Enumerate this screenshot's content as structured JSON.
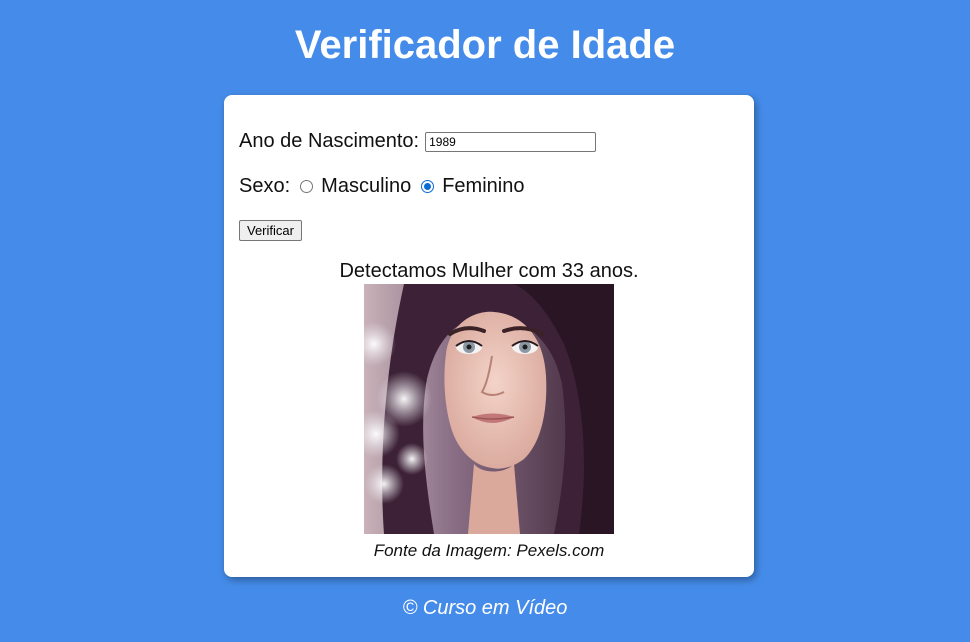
{
  "header": {
    "title": "Verificador de Idade"
  },
  "form": {
    "birth_label": "Ano de Nascimento:",
    "birth_value": "1989",
    "sex_label": "Sexo:",
    "options": [
      {
        "label": "Masculino",
        "checked": false
      },
      {
        "label": "Feminino",
        "checked": true
      }
    ],
    "submit_label": "Verificar"
  },
  "result": {
    "message": "Detectamos Mulher com 33 anos.",
    "image_caption": "Fonte da Imagem: Pexels.com"
  },
  "footer": {
    "text": "© Curso em Vídeo"
  },
  "colors": {
    "background": "#458cea",
    "card": "#ffffff",
    "radio_accent": "#0a6ad6"
  }
}
